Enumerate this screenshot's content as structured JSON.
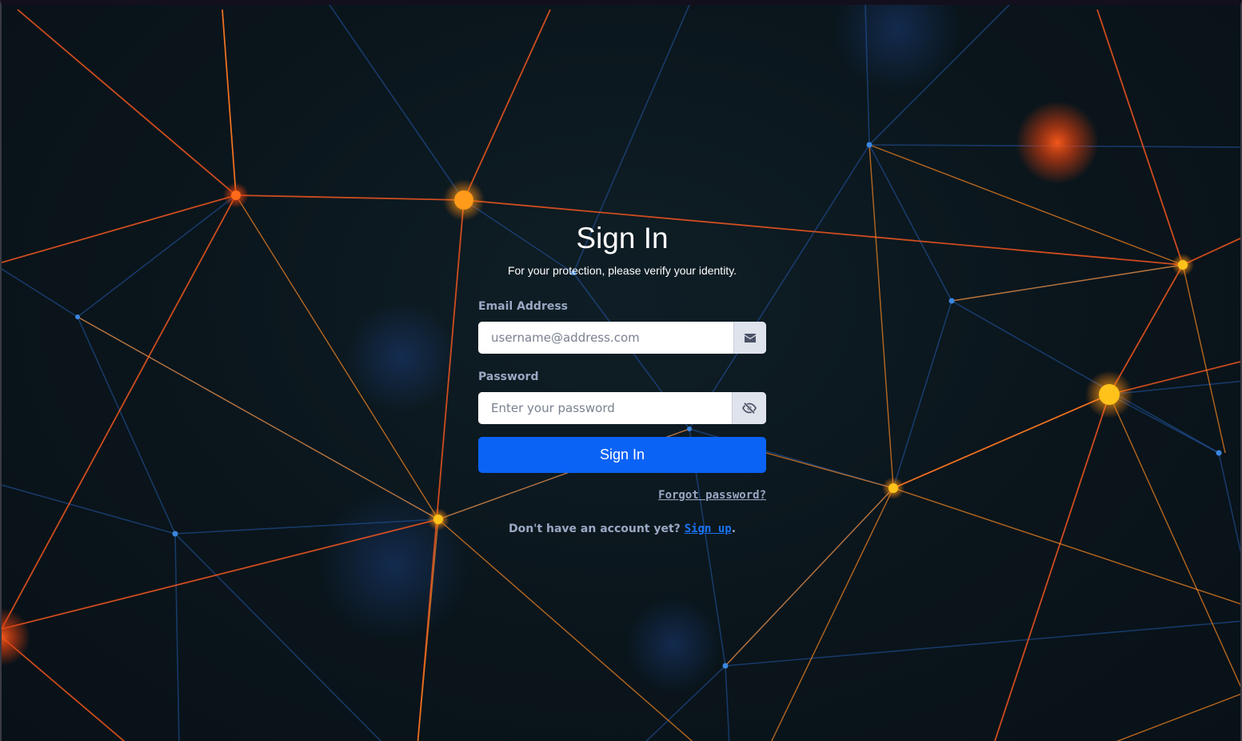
{
  "signin": {
    "title": "Sign In",
    "subtitle": "For your protection, please verify your identity.",
    "email_label": "Email Address",
    "email_placeholder": "username@address.com",
    "email_value": "",
    "password_label": "Password",
    "password_placeholder": "Enter your password",
    "password_value": "",
    "submit_label": "Sign In",
    "forgot_label": "Forgot password?",
    "signup_prompt": "Don't have an account yet?",
    "signup_link": "Sign up",
    "signup_suffix": "."
  },
  "icons": {
    "email_addon": "envelope-icon",
    "password_addon": "eye-slash-icon"
  },
  "colors": {
    "primary_button": "#0b63f6",
    "link": "#1a73f5",
    "muted_label": "#9aa8c4",
    "network_orange": "#ff7a1a",
    "network_blue": "#2a5fb0"
  }
}
